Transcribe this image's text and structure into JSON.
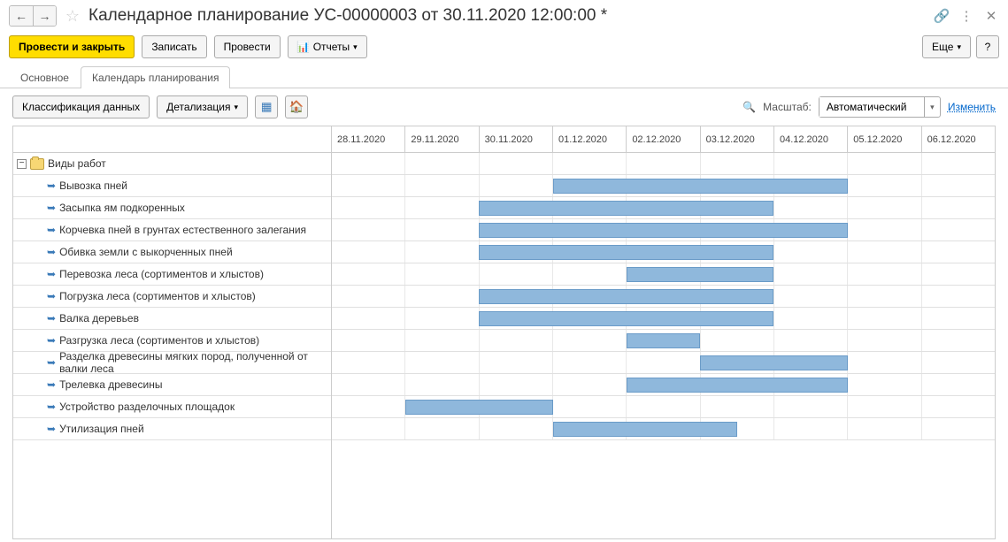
{
  "header": {
    "title": "Календарное планирование УС-00000003 от 30.11.2020 12:00:00 *"
  },
  "toolbar": {
    "post_and_close": "Провести и закрыть",
    "save": "Записать",
    "post": "Провести",
    "reports": "Отчеты",
    "more": "Еще",
    "help": "?"
  },
  "tabs": {
    "main": "Основное",
    "calendar": "Календарь планирования"
  },
  "sub": {
    "classification": "Классификация данных",
    "detail": "Детализация",
    "scale_label": "Масштаб:",
    "scale_value": "Автоматический",
    "change": "Изменить"
  },
  "dates": [
    "28.11.2020",
    "29.11.2020",
    "30.11.2020",
    "01.12.2020",
    "02.12.2020",
    "03.12.2020",
    "04.12.2020",
    "05.12.2020",
    "06.12.2020"
  ],
  "root": "Виды работ",
  "tasks": [
    {
      "name": "Вывозка пней",
      "start": 3,
      "span": 4
    },
    {
      "name": "Засыпка ям подкоренных",
      "start": 2,
      "span": 4
    },
    {
      "name": "Корчевка пней в грунтах естественного залегания",
      "start": 2,
      "span": 5
    },
    {
      "name": "Обивка земли с выкорченных пней",
      "start": 2,
      "span": 4
    },
    {
      "name": "Перевозка леса (сортиментов и хлыстов)",
      "start": 4,
      "span": 2
    },
    {
      "name": "Погрузка леса (сортиментов и хлыстов)",
      "start": 2,
      "span": 4
    },
    {
      "name": "Валка деревьев",
      "start": 2,
      "span": 4
    },
    {
      "name": "Разгрузка леса (сортиментов и хлыстов)",
      "start": 4,
      "span": 1
    },
    {
      "name": "Разделка древесины мягких пород, полученной от валки леса",
      "start": 5,
      "span": 2
    },
    {
      "name": "Трелевка древесины",
      "start": 4,
      "span": 3
    },
    {
      "name": "Устройство разделочных площадок",
      "start": 1,
      "span": 2
    },
    {
      "name": "Утилизация пней",
      "start": 3,
      "span": 2.5
    }
  ]
}
